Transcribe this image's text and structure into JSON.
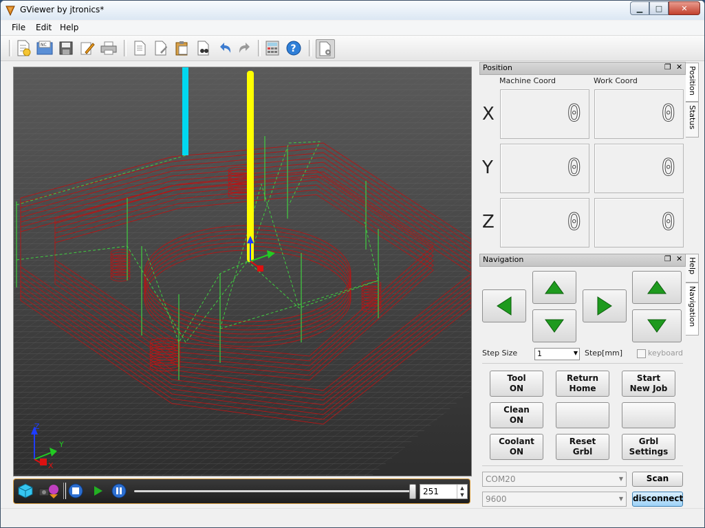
{
  "window": {
    "title": "GViewer by jtronics*"
  },
  "menu": [
    "File",
    "Edit",
    "Help"
  ],
  "toolbar_icons": [
    "new-file-icon",
    "open-nc-icon",
    "save-icon",
    "edit-icon",
    "print-icon",
    "page-icon",
    "page-edit-icon",
    "paste-icon",
    "find-icon",
    "undo-icon",
    "redo-icon",
    "calculator-icon",
    "help-icon",
    "nc-settings-icon"
  ],
  "position": {
    "title": "Position",
    "machine_label": "Machine Coord",
    "work_label": "Work Coord",
    "axes": [
      {
        "axis": "X",
        "machine": "0",
        "work": "0"
      },
      {
        "axis": "Y",
        "machine": "0",
        "work": "0"
      },
      {
        "axis": "Z",
        "machine": "0",
        "work": "0"
      }
    ]
  },
  "side_tabs_top": [
    "Position",
    "Status"
  ],
  "side_tabs_bottom": [
    "Help",
    "Navigation"
  ],
  "navigation": {
    "title": "Navigation",
    "step_label": "Step Size",
    "step_value": "1",
    "step_unit": "Step[mm]",
    "keyboard_label": "keyboard",
    "buttons": [
      {
        "name": "tool-on-button",
        "label": "Tool\nON"
      },
      {
        "name": "return-home-button",
        "label": "Return\nHome"
      },
      {
        "name": "start-new-job-button",
        "label": "Start\nNew Job"
      },
      {
        "name": "clean-on-button",
        "label": "Clean\nON"
      },
      {
        "name": "blank-button-1",
        "label": ""
      },
      {
        "name": "blank-button-2",
        "label": ""
      },
      {
        "name": "coolant-on-button",
        "label": "Coolant\nON"
      },
      {
        "name": "reset-grbl-button",
        "label": "Reset\nGrbl"
      },
      {
        "name": "grbl-settings-button",
        "label": "Grbl\nSettings"
      }
    ]
  },
  "connection": {
    "port": "COM20",
    "baud": "9600",
    "scan_label": "Scan",
    "disconnect_label": "disconnect"
  },
  "playback": {
    "line": "251",
    "progress": 0.99
  },
  "colors": {
    "toolpath": "#b01818",
    "rapid": "#40d040",
    "tool": "#ffff00",
    "tool_prev": "#00d8f0",
    "accent": "#d89c3c"
  }
}
